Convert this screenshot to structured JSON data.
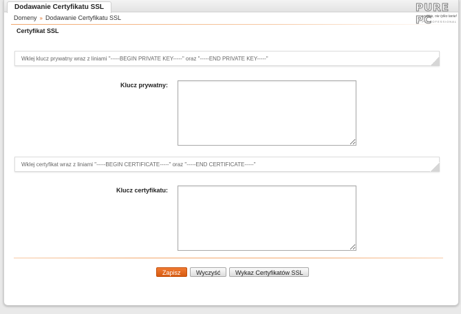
{
  "tab": {
    "title": "Dodawanie Certyfikatu SSL"
  },
  "breadcrumb": {
    "items": [
      "Domeny",
      "Dodawanie Certyfikatu SSL"
    ],
    "separator": "»"
  },
  "section": {
    "title": "Certyfikat SSL"
  },
  "private_key": {
    "hint": "Wklej klucz prywatny wraz z liniami \"-----BEGIN PRIVATE KEY-----\" oraz \"-----END PRIVATE KEY-----\"",
    "label": "Klucz prywatny:",
    "value": ""
  },
  "certificate": {
    "hint": "Wklej certyfikat wraz z liniami \"-----BEGIN CERTIFICATE-----\" oraz \"-----END CERTIFICATE-----\"",
    "label": "Klucz certyfikatu:",
    "value": ""
  },
  "buttons": {
    "save": "Zapisz",
    "clear": "Wyczyść",
    "list": "Wykaz Certyfikatów SSL"
  },
  "watermark": {
    "main": "PURE PC",
    "tagline": "szybkie, nie tylko tanie!",
    "sub": "PCPROFESSIONAL"
  },
  "colors": {
    "accent": "#e06a1b",
    "primary_button": "#e46a22"
  }
}
